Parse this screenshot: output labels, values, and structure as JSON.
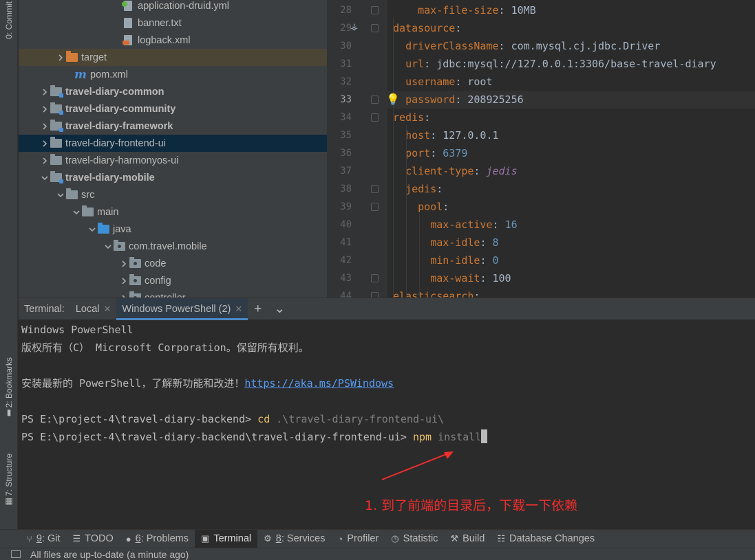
{
  "left_strip": {
    "commit_tab": "0: Commit",
    "bookmarks_tab": "2: Bookmarks",
    "structure_tab": "7: Structure"
  },
  "project_tree": [
    {
      "label": "application-druid.yml",
      "icon": "yml-file-icon",
      "arrow": "none",
      "bold": false
    },
    {
      "label": "banner.txt",
      "icon": "text-file-icon",
      "arrow": "none",
      "bold": false
    },
    {
      "label": "logback.xml",
      "icon": "xml-file-icon",
      "arrow": "none",
      "bold": false
    },
    {
      "label": "target",
      "icon": "excluded-folder-icon",
      "arrow": "right",
      "bold": false
    },
    {
      "label": "pom.xml",
      "icon": "maven-icon",
      "arrow": "none",
      "bold": false
    },
    {
      "label": "travel-diary-common",
      "icon": "module-folder-icon",
      "arrow": "right",
      "bold": true
    },
    {
      "label": "travel-diary-community",
      "icon": "module-folder-icon",
      "arrow": "right",
      "bold": true
    },
    {
      "label": "travel-diary-framework",
      "icon": "module-folder-icon",
      "arrow": "right",
      "bold": true
    },
    {
      "label": "travel-diary-frontend-ui",
      "icon": "folder-icon",
      "arrow": "right",
      "bold": false
    },
    {
      "label": "travel-diary-harmonyos-ui",
      "icon": "folder-icon",
      "arrow": "right",
      "bold": false
    },
    {
      "label": "travel-diary-mobile",
      "icon": "module-folder-icon",
      "arrow": "down",
      "bold": true
    },
    {
      "label": "src",
      "icon": "folder-icon",
      "arrow": "down",
      "bold": false
    },
    {
      "label": "main",
      "icon": "folder-icon",
      "arrow": "down",
      "bold": false
    },
    {
      "label": "java",
      "icon": "source-folder-icon",
      "arrow": "down",
      "bold": false
    },
    {
      "label": "com.travel.mobile",
      "icon": "package-icon",
      "arrow": "down",
      "bold": false
    },
    {
      "label": "code",
      "icon": "package-icon",
      "arrow": "right",
      "bold": false
    },
    {
      "label": "config",
      "icon": "package-icon",
      "arrow": "right",
      "bold": false
    },
    {
      "label": "controller",
      "icon": "package-icon",
      "arrow": "right",
      "bold": false
    }
  ],
  "editor": {
    "current_line": 33,
    "lines": [
      {
        "num": "28",
        "key": "max-file-size",
        "sep": ": ",
        "value": "10MB",
        "vtype": "plain"
      },
      {
        "num": "29",
        "key": "datasource",
        "sep": ":",
        "value": "",
        "vtype": "plain"
      },
      {
        "num": "30",
        "key": "driverClassName",
        "sep": ": ",
        "value": "com.mysql.cj.jdbc.Driver",
        "vtype": "plain"
      },
      {
        "num": "31",
        "key": "url",
        "sep": ": ",
        "value": "jdbc:mysql://127.0.0.1:3306/base-travel-diary",
        "vtype": "plain"
      },
      {
        "num": "32",
        "key": "username",
        "sep": ": ",
        "value": "root",
        "vtype": "plain"
      },
      {
        "num": "33",
        "key": "password",
        "sep": ": ",
        "value": "208925256",
        "vtype": "plain"
      },
      {
        "num": "34",
        "key": "redis",
        "sep": ":",
        "value": "",
        "vtype": "plain"
      },
      {
        "num": "35",
        "key": "host",
        "sep": ": ",
        "value": "127.0.0.1",
        "vtype": "plain"
      },
      {
        "num": "36",
        "key": "port",
        "sep": ": ",
        "value": "6379",
        "vtype": "number"
      },
      {
        "num": "37",
        "key": "client-type",
        "sep": ": ",
        "value": "jedis",
        "vtype": "italic"
      },
      {
        "num": "38",
        "key": "jedis",
        "sep": ":",
        "value": "",
        "vtype": "plain"
      },
      {
        "num": "39",
        "key": "pool",
        "sep": ":",
        "value": "",
        "vtype": "plain"
      },
      {
        "num": "40",
        "key": "max-active",
        "sep": ": ",
        "value": "16",
        "vtype": "number"
      },
      {
        "num": "41",
        "key": "max-idle",
        "sep": ": ",
        "value": "8",
        "vtype": "number"
      },
      {
        "num": "42",
        "key": "min-idle",
        "sep": ": ",
        "value": "0",
        "vtype": "number"
      },
      {
        "num": "43",
        "key": "max-wait",
        "sep": ": ",
        "value": "100",
        "vtype": "plain"
      },
      {
        "num": "44",
        "key": "elasticsearch",
        "sep": ":",
        "value": "",
        "vtype": "plain"
      }
    ]
  },
  "terminal": {
    "title": "Terminal:",
    "tabs": [
      {
        "label": "Local",
        "active": false
      },
      {
        "label": "Windows PowerShell (2)",
        "active": true
      }
    ],
    "add_label": "+",
    "lines": {
      "l1": "Windows PowerShell",
      "l2": "版权所有（C） Microsoft Corporation。保留所有权利。",
      "l3_text": "安装最新的 PowerShell，了解新功能和改进！",
      "l3_link": "https://aka.ms/PSWindows",
      "p1_prompt": "PS E:\\project-4\\travel-diary-backend> ",
      "p1_cmd": "cd",
      "p1_arg": " .\\travel-diary-frontend-ui\\",
      "p2_prompt": "PS E:\\project-4\\travel-diary-backend\\travel-diary-frontend-ui> ",
      "p2_cmd": "npm",
      "p2_arg": " install"
    },
    "annotation": "1. 到了前端的目录后，下载一下依赖",
    "annotation_color": "#f02d2d"
  },
  "toolbar": {
    "items": [
      {
        "prefix": "9",
        "label": ": Git",
        "icon": "git-branch-icon",
        "active": false
      },
      {
        "prefix": "",
        "label": "TODO",
        "icon": "list-icon",
        "active": false
      },
      {
        "prefix": "6",
        "label": ": Problems",
        "icon": "problems-icon",
        "active": false
      },
      {
        "prefix": "",
        "label": "Terminal",
        "icon": "terminal-icon",
        "active": true
      },
      {
        "prefix": "8",
        "label": ": Services",
        "icon": "services-icon",
        "active": false
      },
      {
        "prefix": "",
        "label": "Profiler",
        "icon": "profiler-icon",
        "active": false
      },
      {
        "prefix": "",
        "label": "Statistic",
        "icon": "statistic-icon",
        "active": false
      },
      {
        "prefix": "",
        "label": "Build",
        "icon": "hammer-icon",
        "active": false
      },
      {
        "prefix": "",
        "label": "Database Changes",
        "icon": "database-icon",
        "active": false
      }
    ]
  },
  "status": {
    "message": "All files are up-to-date (a minute ago)"
  }
}
